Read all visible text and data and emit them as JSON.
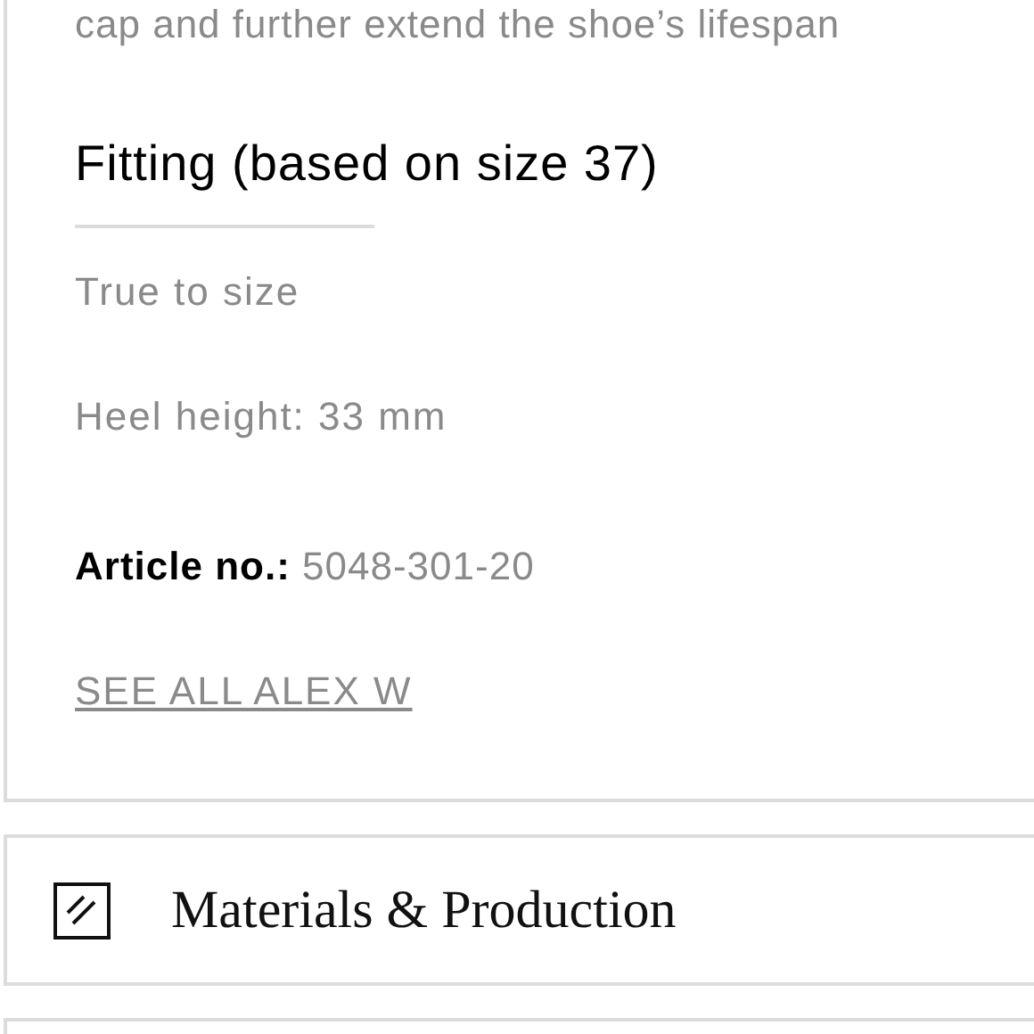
{
  "description_tail": "cap and further extend the shoe’s lifespan",
  "fitting": {
    "heading": "Fitting (based on size 37)",
    "lines": [
      "True to size",
      "Heel height: 33 mm"
    ]
  },
  "article": {
    "label": "Article no.:",
    "value": "5048-301-20"
  },
  "link": "SEE ALL ALEX W",
  "sections": [
    {
      "title": "Materials & Production"
    }
  ]
}
